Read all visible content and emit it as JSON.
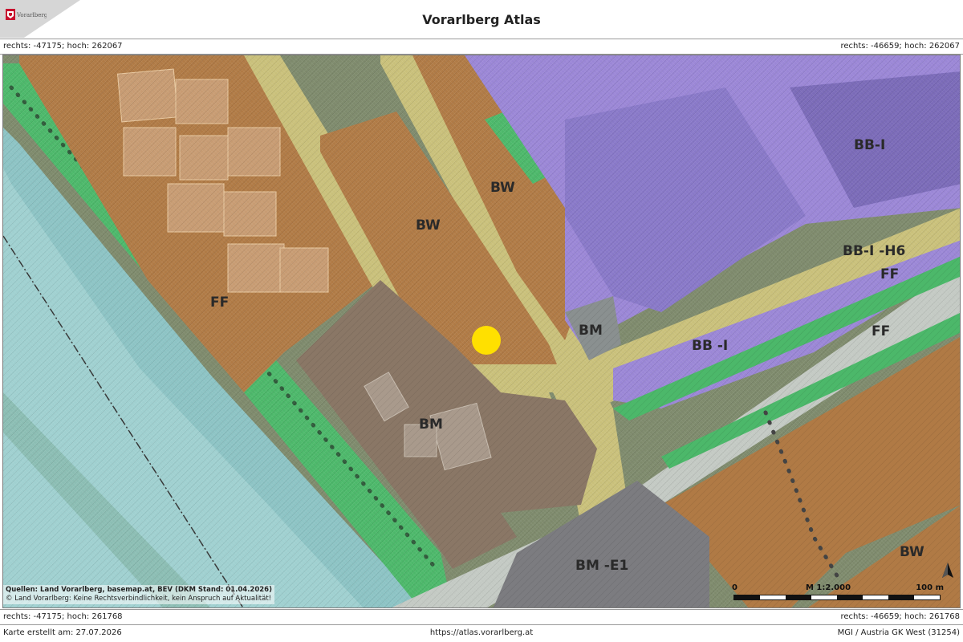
{
  "header": {
    "title": "Vorarlberg Atlas",
    "logo_text": "Vorarlberg"
  },
  "coords": {
    "top_left": "rechts: -47175; hoch: 262067",
    "top_right": "rechts: -46659; hoch: 262067",
    "bottom_left": "rechts: -47175; hoch: 261768",
    "bottom_right": "rechts: -46659; hoch: 261768"
  },
  "map": {
    "zones": [
      {
        "id": "bw-1",
        "label": "BW"
      },
      {
        "id": "bw-2",
        "label": "BW"
      },
      {
        "id": "bw-3",
        "label": "BW"
      },
      {
        "id": "bbi-1",
        "label": "BB-I"
      },
      {
        "id": "bbi-h6",
        "label": "BB-I -H6"
      },
      {
        "id": "bbi-2",
        "label": "BB -I"
      },
      {
        "id": "bm-1",
        "label": "BM"
      },
      {
        "id": "bm-2",
        "label": "BM"
      },
      {
        "id": "bm-e1",
        "label": "BM -E1"
      },
      {
        "id": "ff-1",
        "label": "FF"
      },
      {
        "id": "ff-2",
        "label": "FF"
      },
      {
        "id": "ff-3",
        "label": "FF"
      }
    ],
    "marker": {
      "color": "#ffe000"
    },
    "colors": {
      "residential": "#b07a45",
      "industrial": "#9a86d6",
      "mixed": "#8a7766",
      "green": "#4cb86a",
      "road": "#c9c07a",
      "river": "#8cc3c4"
    }
  },
  "sources": {
    "line1": "Quellen: Land Vorarlberg, basemap.at, BEV (DKM Stand: 01.04.2026)",
    "line2": "© Land Vorarlberg: Keine Rechtsverbindlichkeit, kein Anspruch auf Aktualität!"
  },
  "scalebar": {
    "start": "0",
    "scale": "M 1:2.000",
    "end": "100 m"
  },
  "footer": {
    "created": "Karte erstellt am: 27.07.2026",
    "url": "https://atlas.vorarlberg.at",
    "projection": "MGI / Austria GK West (31254)"
  }
}
